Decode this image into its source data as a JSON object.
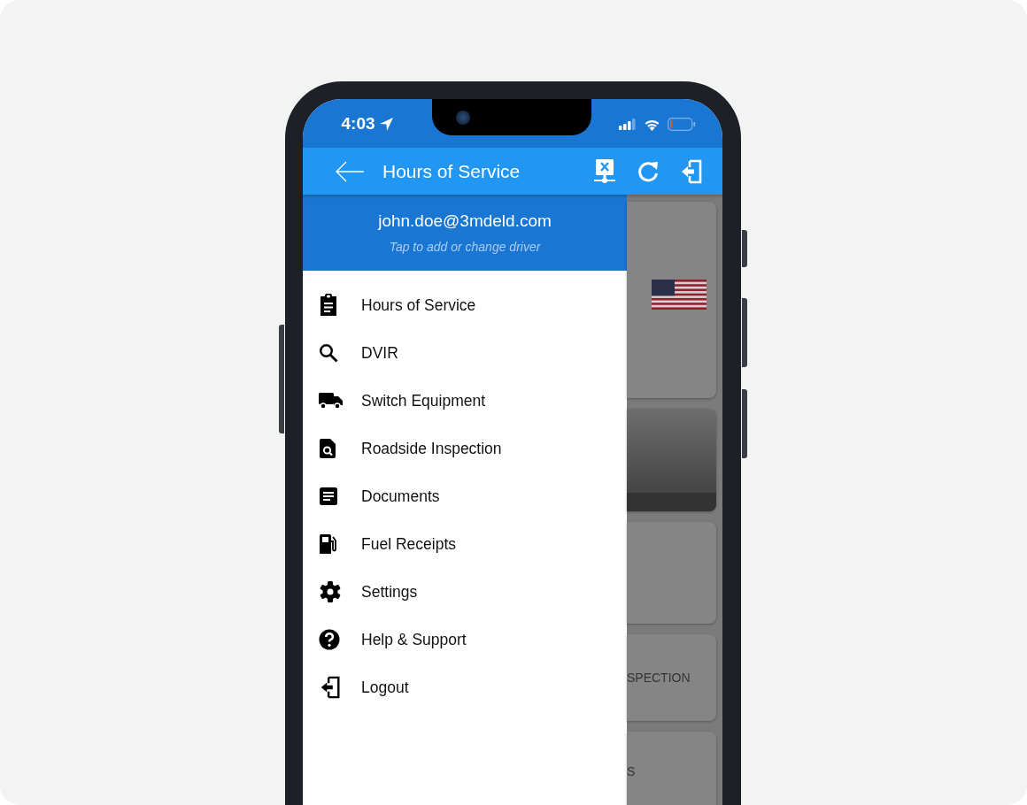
{
  "status_bar": {
    "time": "4:03",
    "location_on": true
  },
  "app_bar": {
    "title": "Hours of Service"
  },
  "drawer": {
    "header": {
      "email": "john.doe@3mdeld.com",
      "hint": "Tap to add or change driver"
    },
    "items": [
      {
        "label": "Hours of Service"
      },
      {
        "label": "DVIR"
      },
      {
        "label": "Switch Equipment"
      },
      {
        "label": "Roadside Inspection"
      },
      {
        "label": "Documents"
      },
      {
        "label": "Fuel Receipts"
      },
      {
        "label": "Settings"
      },
      {
        "label": "Help & Support"
      },
      {
        "label": "Logout"
      }
    ]
  },
  "background_cards": [
    {
      "kind": "flag"
    },
    {
      "kind": "picture"
    },
    {
      "kind": "blank"
    },
    {
      "kind": "text",
      "text": "SPECTION"
    },
    {
      "kind": "text",
      "text": "S"
    }
  ]
}
